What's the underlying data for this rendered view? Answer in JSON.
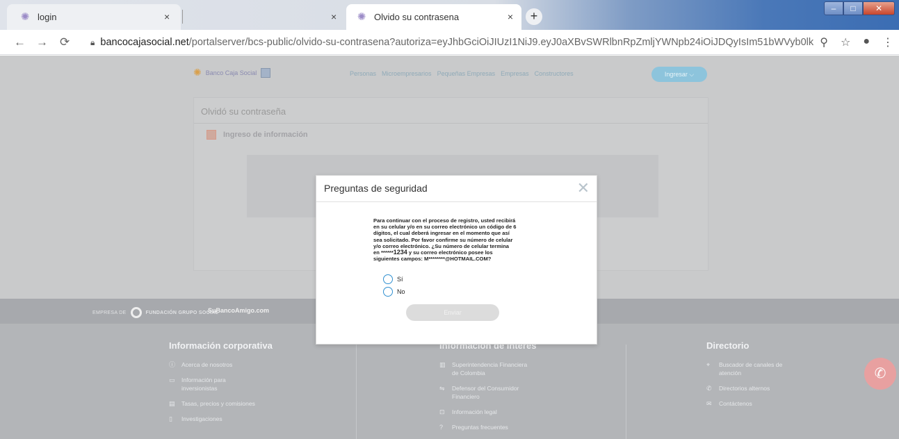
{
  "browser": {
    "tabs": [
      {
        "title": "login",
        "active": false
      },
      {
        "title": "Olvido su contrasena",
        "active": true
      }
    ],
    "url_host": "bancocajasocial.net",
    "url_rest": "/portalserver/bcs-public/olvido-su-contrasena?autoriza=eyJhbGciOiJIUzI1NiJ9.eyJ0aXBvSWRlbnRpZmljYWNpb24iOiJDQyIsIm51bWVyb0lkZ..."
  },
  "site": {
    "logo_text": "Banco Caja Social",
    "nav": [
      "Personas",
      "Microempresarios",
      "Pequeñas Empresas",
      "Empresas",
      "Constructores"
    ],
    "login_button": "Ingresar",
    "page_title": "Olvidó su contraseña",
    "step_label": "Ingreso de información"
  },
  "modal": {
    "title": "Preguntas de seguridad",
    "message_line1": "Para continuar con el proceso de registro, usted recibirá",
    "message_line2": "en su celular y/o en su correo electrónico un código de 6",
    "message_line3": "dígitos, el cual deberá ingresar en el momento que así",
    "message_line4": "sea solicitado. Por favor confirme su número de celular",
    "message_line5": "y/o correo electrónico. ¿Su número de celular termina",
    "message_line6_a": "en ******",
    "message_line6_b": "1234",
    "message_line6_c": " y su correo electrónico posee los",
    "message_line7": "siguientes campos: M********@HOTMAIL.COM?",
    "option_yes": "Sí",
    "option_no": "No",
    "send_button": "Enviar"
  },
  "footer": {
    "empresa_de": "EMPRESA DE",
    "fundacion": "FUNDACIÓN GRUPO SOCIAL",
    "site_link": "SuBancoAmigo.com",
    "col1": {
      "title": "Información corporativa",
      "items": [
        "Acerca de nosotros",
        "Información para",
        "inversionistas",
        "Tasas, precios y comisiones",
        "Investigaciones"
      ]
    },
    "col2": {
      "title": "Información de interés",
      "items": [
        "Superintendencia Financiera",
        "de Colombia",
        "Defensor del Consumidor",
        "Financiero",
        "Información legal",
        "Preguntas frecuentes"
      ]
    },
    "col3": {
      "title": "Directorio",
      "items": [
        "Buscador de canales de",
        "atención",
        "Directorios alternos",
        "Contáctenos"
      ]
    }
  }
}
